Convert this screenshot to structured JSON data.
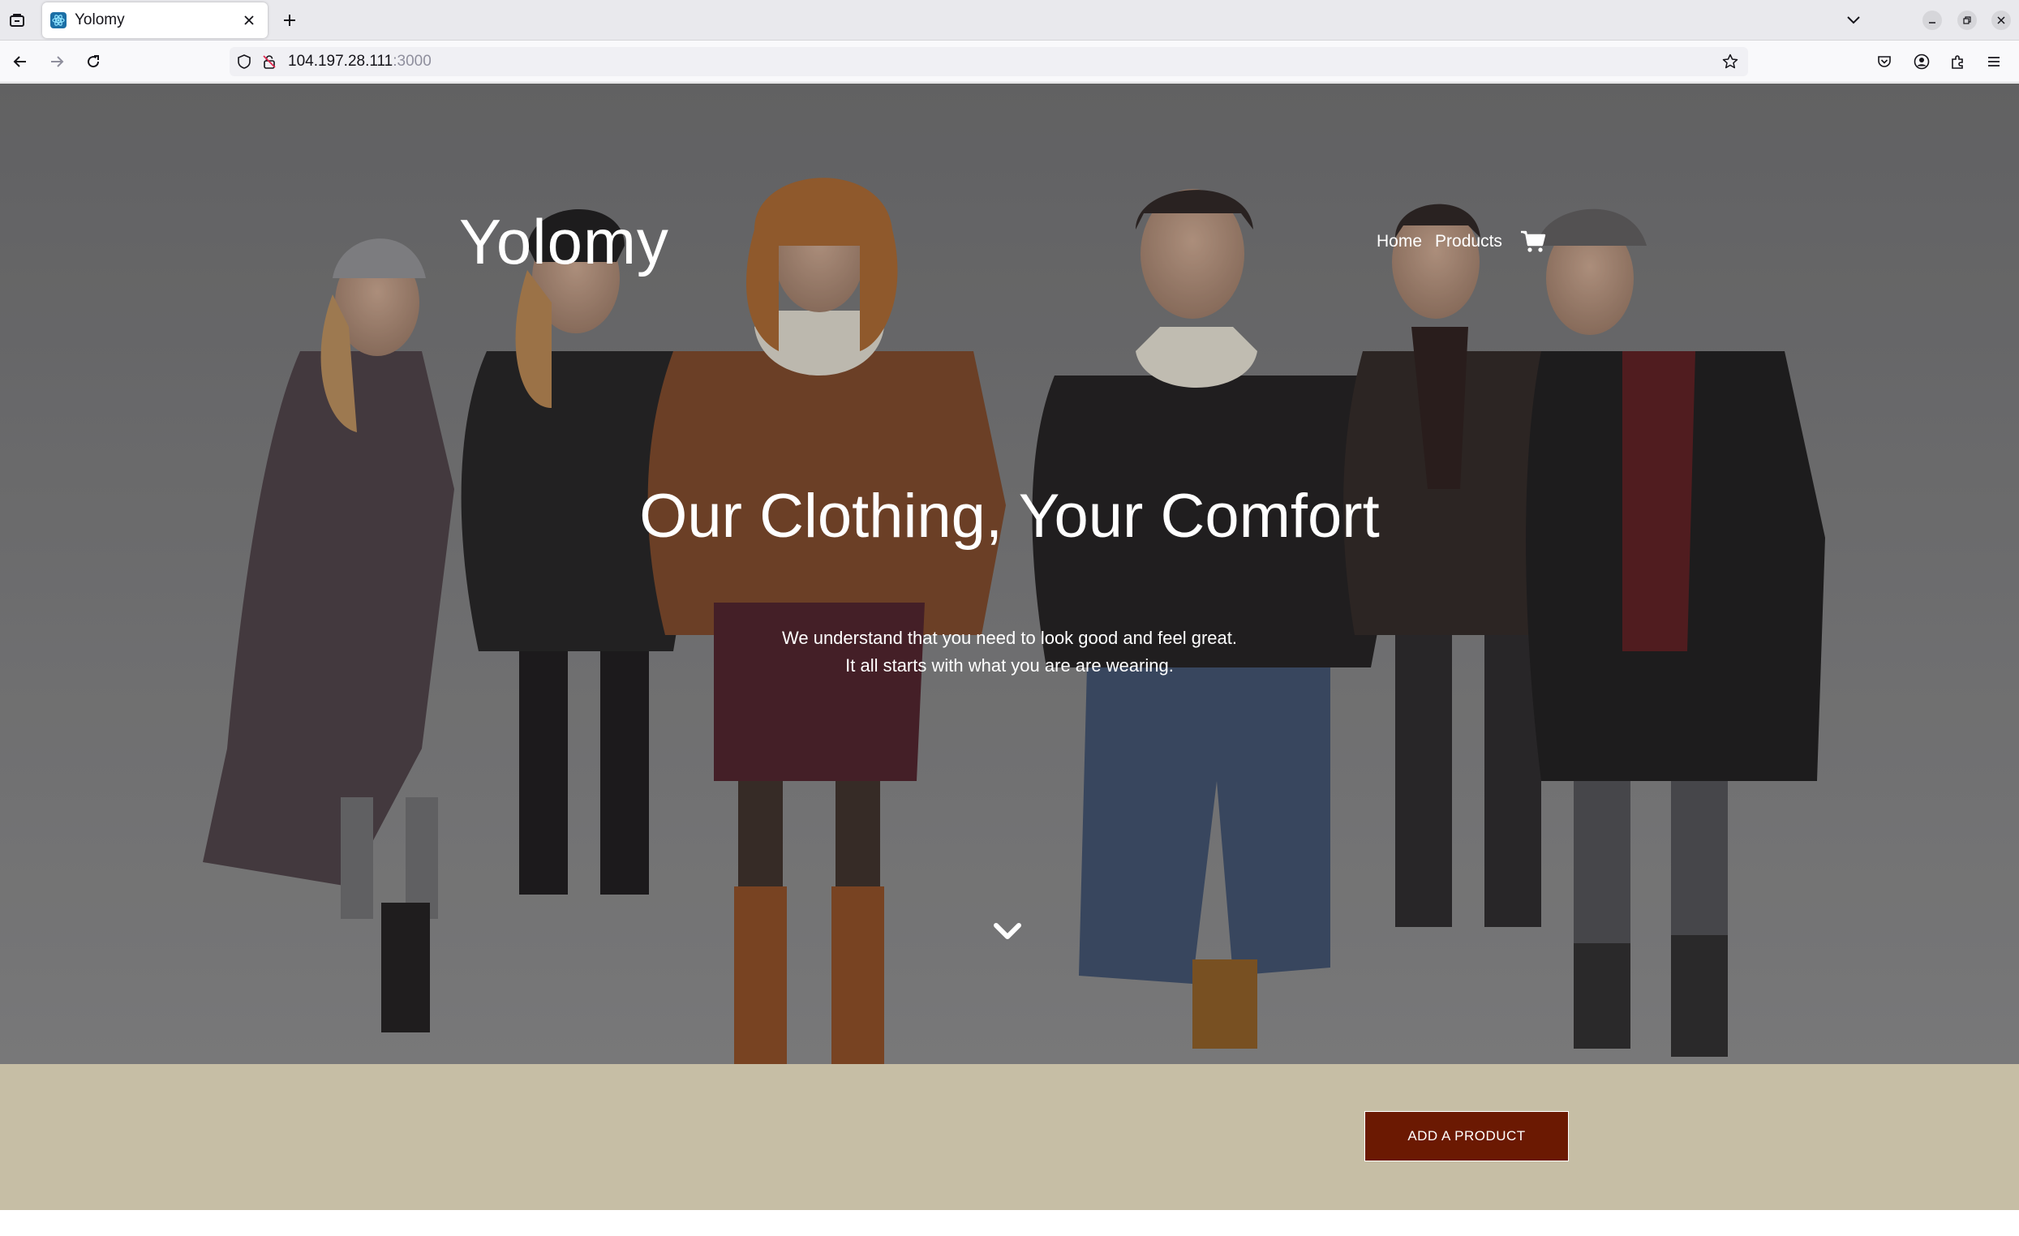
{
  "browser": {
    "tab_title": "Yolomy",
    "url_host": "104.197.28.111",
    "url_port": ":3000"
  },
  "site": {
    "brand": "Yolomy",
    "nav": [
      {
        "label": "Home"
      },
      {
        "label": "Products"
      }
    ],
    "hero": {
      "headline": "Our Clothing, Your Comfort",
      "subtext_line1": "We understand that you need to look good and feel great.",
      "subtext_line2": "It all starts with what you are are wearing."
    },
    "actions": {
      "add_product_label": "ADD A PRODUCT"
    }
  },
  "icons": {
    "cart": "cart-icon",
    "scroll": "chevron-down-icon"
  },
  "colors": {
    "band_background": "#c6bea5",
    "button_background": "#6b1902",
    "hero_text": "#ffffff"
  }
}
